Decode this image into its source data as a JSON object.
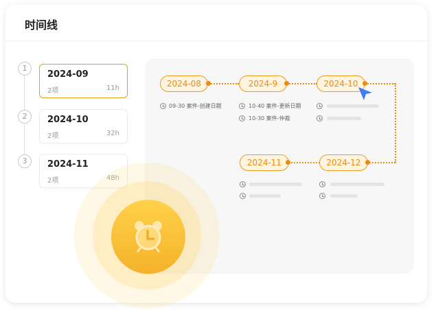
{
  "page_title": "时间线",
  "sidebar": {
    "items": [
      {
        "num": "1",
        "date": "2024-09",
        "count": "2项",
        "hours": "11h",
        "active": true
      },
      {
        "num": "2",
        "date": "2024-10",
        "count": "2项",
        "hours": "32h",
        "active": false
      },
      {
        "num": "3",
        "date": "2024-11",
        "count": "2项",
        "hours": "48h",
        "active": false
      }
    ]
  },
  "timeline": {
    "nodes": [
      "2024-08",
      "2024-9",
      "2024-10",
      "2024-11",
      "2024-12"
    ],
    "events": {
      "n0": [
        "09-30 案件-创建日期"
      ],
      "n1": [
        "10-40 案件-更新日期",
        "10-30 案件-仲裁"
      ]
    }
  },
  "colors": {
    "accent": "#ee8a12",
    "active_border": "#e9a11c",
    "cursor": "#3d7ef5",
    "alarm": "#f5b82e"
  },
  "icons": [
    "clock-icon",
    "alarm-clock-icon",
    "cursor-arrow-icon"
  ]
}
